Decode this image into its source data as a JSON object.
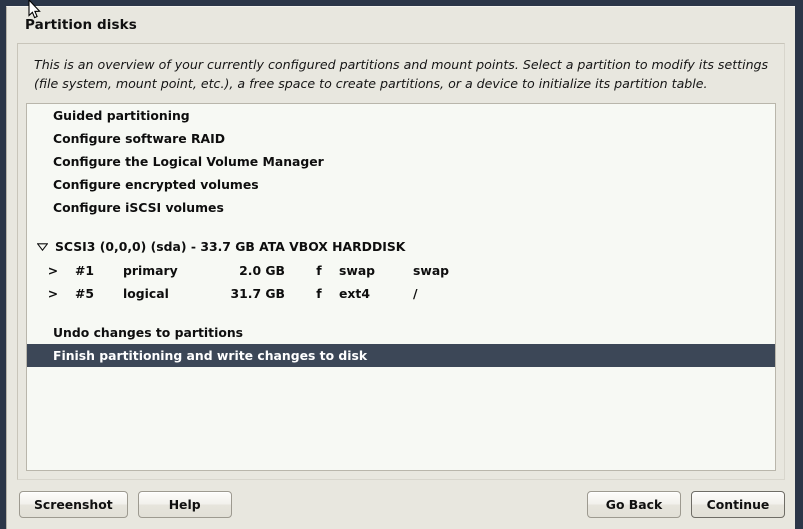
{
  "window": {
    "title": "Partition disks"
  },
  "description": {
    "line1": "This is an overview of your currently configured partitions and mount points. Select a partition to modify its settings",
    "line2": "(file system, mount point, etc.), a free space to create partitions, or a device to initialize its partition table."
  },
  "menu_items": [
    {
      "label": "Guided partitioning"
    },
    {
      "label": "Configure software RAID"
    },
    {
      "label": "Configure the Logical Volume Manager"
    },
    {
      "label": "Configure encrypted volumes"
    },
    {
      "label": "Configure iSCSI volumes"
    }
  ],
  "device": {
    "expander_icon": "triangle-down-icon",
    "expanded": true,
    "label": "SCSI3 (0,0,0) (sda) - 33.7 GB ATA VBOX HARDDISK"
  },
  "partitions": [
    {
      "marker": ">",
      "number": "#1",
      "type": "primary",
      "size": "2.0 GB",
      "flag": "f",
      "filesystem": "swap",
      "mountpoint": "swap"
    },
    {
      "marker": ">",
      "number": "#5",
      "type": "logical",
      "size": "31.7 GB",
      "flag": "f",
      "filesystem": "ext4",
      "mountpoint": "/"
    }
  ],
  "actions": [
    {
      "label": "Undo changes to partitions",
      "selected": false
    },
    {
      "label": "Finish partitioning and write changes to disk",
      "selected": true
    }
  ],
  "buttons": {
    "screenshot": "Screenshot",
    "help": "Help",
    "go_back": "Go Back",
    "continue": "Continue"
  },
  "colors": {
    "desktop": "#2b3648",
    "dialog_bg": "#e8e7df",
    "list_bg": "#f7f9f4",
    "selection_bg": "#3c4757",
    "selection_fg": "#ffffff",
    "text": "#0e0e0e"
  },
  "cursor": {
    "icon": "mouse-pointer-icon"
  }
}
